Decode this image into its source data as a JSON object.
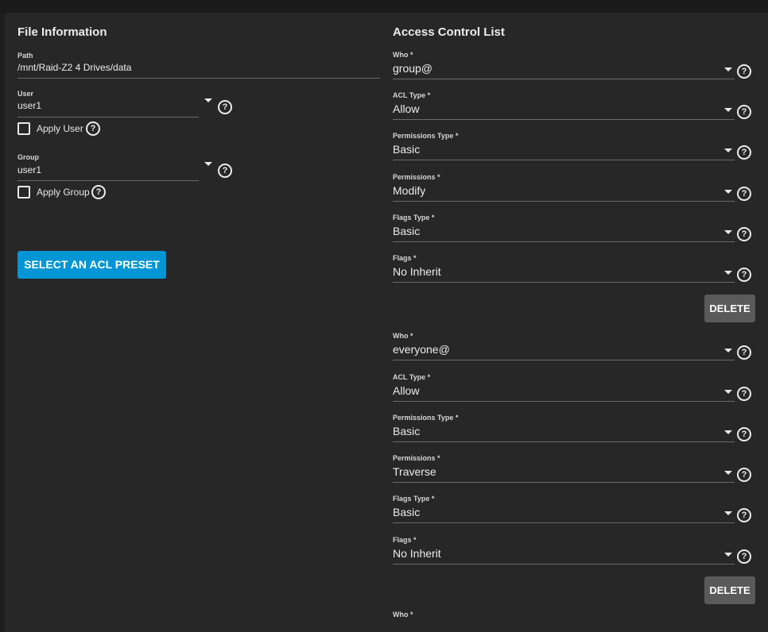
{
  "file_info": {
    "title": "File Information",
    "path_label": "Path",
    "path_value": "/mnt/Raid-Z2  4 Drives/data",
    "user_label": "User",
    "user_value": "user1",
    "apply_user_label": "Apply User",
    "group_label": "Group",
    "group_value": "user1",
    "apply_group_label": "Apply Group",
    "preset_button": "SELECT AN ACL PRESET"
  },
  "acl": {
    "title": "Access Control List",
    "delete_label": "DELETE",
    "partial_next_label": "Who *",
    "entries": [
      {
        "who_label": "Who *",
        "who": "group@",
        "acl_type_label": "ACL Type *",
        "acl_type": "Allow",
        "perm_type_label": "Permissions Type *",
        "perm_type": "Basic",
        "perms_label": "Permissions *",
        "perms": "Modify",
        "flags_type_label": "Flags Type *",
        "flags_type": "Basic",
        "flags_label": "Flags *",
        "flags": "No Inherit"
      },
      {
        "who_label": "Who *",
        "who": "everyone@",
        "acl_type_label": "ACL Type *",
        "acl_type": "Allow",
        "perm_type_label": "Permissions Type *",
        "perm_type": "Basic",
        "perms_label": "Permissions *",
        "perms": "Traverse",
        "flags_type_label": "Flags Type *",
        "flags_type": "Basic",
        "flags_label": "Flags *",
        "flags": "No Inherit"
      }
    ]
  },
  "icons": {
    "help": "help-circle-icon",
    "dropdown": "caret-down-icon",
    "checkbox": "checkbox-empty-icon"
  },
  "colors": {
    "primary": "#0095d5",
    "delete": "#5a5a5a",
    "background": "#272727"
  }
}
